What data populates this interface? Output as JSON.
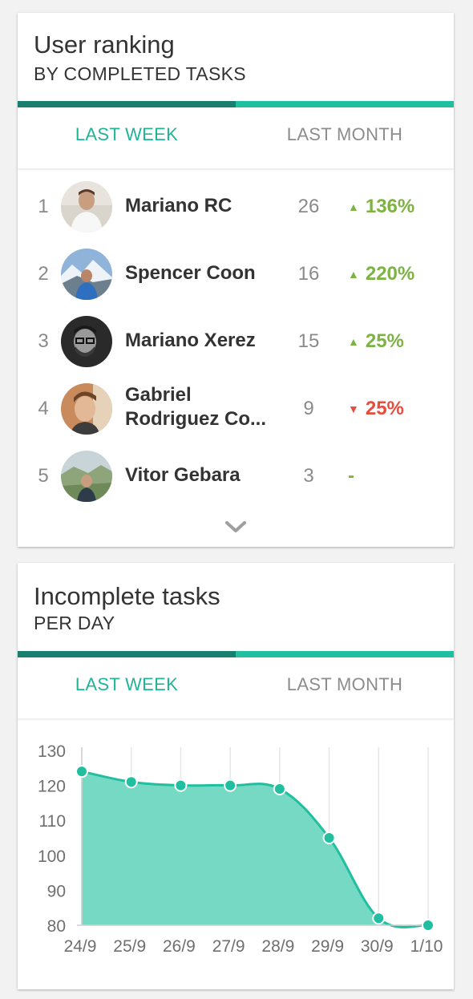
{
  "ranking": {
    "title": "User ranking",
    "subtitle": "BY COMPLETED TASKS",
    "tabs": [
      "LAST WEEK",
      "LAST MONTH"
    ],
    "users": [
      {
        "rank": "1",
        "name": "Mariano RC",
        "count": "26",
        "trend": "136%",
        "direction": "up"
      },
      {
        "rank": "2",
        "name": "Spencer Coon",
        "count": "16",
        "trend": "220%",
        "direction": "up"
      },
      {
        "rank": "3",
        "name": "Mariano Xerez",
        "count": "15",
        "trend": "25%",
        "direction": "up"
      },
      {
        "rank": "4",
        "name": "Gabriel Rodriguez Co...",
        "count": "9",
        "trend": "25%",
        "direction": "down"
      },
      {
        "rank": "5",
        "name": "Vitor Gebara",
        "count": "3",
        "trend": "-",
        "direction": "none"
      }
    ]
  },
  "incomplete": {
    "title": "Incomplete tasks",
    "subtitle": "PER DAY",
    "tabs": [
      "LAST WEEK",
      "LAST MONTH"
    ]
  },
  "colors": {
    "accent": "#1fbf9f",
    "accent_dark": "#1a7f6f",
    "up": "#7cb342",
    "down": "#e74c3c"
  },
  "chart_data": {
    "type": "area",
    "categories": [
      "24/9",
      "25/9",
      "26/9",
      "27/9",
      "28/9",
      "29/9",
      "30/9",
      "1/10"
    ],
    "values": [
      124,
      121,
      120,
      120,
      119,
      105,
      82,
      80
    ],
    "ylim": [
      80,
      130
    ],
    "yticks": [
      130,
      120,
      110,
      100,
      90,
      80
    ],
    "grid": true,
    "title": "",
    "xlabel": "",
    "ylabel": ""
  }
}
